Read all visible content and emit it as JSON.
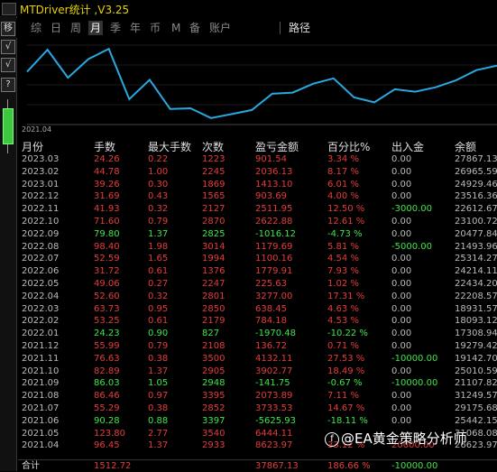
{
  "title": "MTDriver统计 ,V3.25",
  "tabs": [
    "综",
    "日",
    "周",
    "月",
    "季",
    "年",
    "币",
    "M",
    "备",
    "账户",
    "路径"
  ],
  "active_tab": "月",
  "left_buttons": [
    "移",
    "√",
    "√",
    "?"
  ],
  "chart_date": "2021.04",
  "headers": [
    "月份",
    "手数",
    "最大手数",
    "次数",
    "盈亏金额",
    "百分比%",
    "出入金",
    "余额"
  ],
  "rows": [
    [
      "2023.03",
      "24.26",
      "0.22",
      "1223",
      "901.54",
      "3.34 %",
      "0.00",
      "27867.13"
    ],
    [
      "2023.02",
      "44.78",
      "1.00",
      "2245",
      "2036.13",
      "8.17 %",
      "0.00",
      "26965.59"
    ],
    [
      "2023.01",
      "39.26",
      "0.30",
      "1869",
      "1413.10",
      "6.01 %",
      "0.00",
      "24929.46"
    ],
    [
      "2022.12",
      "31.69",
      "0.43",
      "1565",
      "903.69",
      "4.00 %",
      "0.00",
      "23516.36"
    ],
    [
      "2022.11",
      "41.93",
      "0.32",
      "2127",
      "2511.95",
      "12.50 %",
      "-3000.00",
      "22612.67"
    ],
    [
      "2022.10",
      "71.60",
      "0.79",
      "2870",
      "2622.88",
      "12.61 %",
      "0.00",
      "23100.72"
    ],
    [
      "2022.09",
      "79.80",
      "1.37",
      "2825",
      "-1016.12",
      "-4.73 %",
      "0.00",
      "20477.84"
    ],
    [
      "2022.08",
      "98.40",
      "1.98",
      "3014",
      "1179.69",
      "5.81 %",
      "-5000.00",
      "21493.96"
    ],
    [
      "2022.07",
      "52.59",
      "1.65",
      "1994",
      "1100.16",
      "4.54 %",
      "0.00",
      "25314.27"
    ],
    [
      "2022.06",
      "31.72",
      "0.61",
      "1376",
      "1779.91",
      "7.93 %",
      "0.00",
      "24214.11"
    ],
    [
      "2022.05",
      "49.06",
      "0.27",
      "2247",
      "225.63",
      "1.02 %",
      "0.00",
      "22434.20"
    ],
    [
      "2022.04",
      "52.60",
      "0.32",
      "2801",
      "3277.00",
      "17.31 %",
      "0.00",
      "22208.57"
    ],
    [
      "2022.03",
      "63.73",
      "0.95",
      "2850",
      "638.45",
      "4.63 %",
      "0.00",
      "18931.57"
    ],
    [
      "2022.02",
      "53.25",
      "0.61",
      "2179",
      "784.18",
      "4.53 %",
      "0.00",
      "18093.12"
    ],
    [
      "2022.01",
      "24.23",
      "0.90",
      "827",
      "-1970.48",
      "-10.22 %",
      "0.00",
      "17308.94"
    ],
    [
      "2021.12",
      "55.99",
      "0.79",
      "2108",
      "136.72",
      "0.71 %",
      "0.00",
      "19279.42"
    ],
    [
      "2021.11",
      "76.63",
      "0.38",
      "3500",
      "4132.11",
      "27.53 %",
      "-10000.00",
      "19142.70"
    ],
    [
      "2021.10",
      "82.89",
      "1.37",
      "2905",
      "3902.77",
      "18.49 %",
      "0.00",
      "25010.59"
    ],
    [
      "2021.09",
      "86.03",
      "1.05",
      "2948",
      "-141.75",
      "-0.67 %",
      "-10000.00",
      "21107.82"
    ],
    [
      "2021.08",
      "86.46",
      "0.97",
      "3395",
      "2073.89",
      "7.11 %",
      "0.00",
      "31249.57"
    ],
    [
      "2021.07",
      "55.29",
      "0.38",
      "2852",
      "3733.53",
      "14.67 %",
      "0.00",
      "29175.68"
    ],
    [
      "2021.06",
      "90.28",
      "0.88",
      "3397",
      "-5625.93",
      "-18.11 %",
      "0.00",
      "25442.15"
    ],
    [
      "2021.05",
      "123.80",
      "2.77",
      "3540",
      "6444.11",
      "",
      "",
      "31068.08"
    ],
    [
      "2021.04",
      "96.45",
      "1.37",
      "2933",
      "8623.97",
      "33.12 %",
      "20000.00",
      "26623.97"
    ]
  ],
  "total": [
    "合计",
    "1512.72",
    "",
    "",
    "37867.13",
    "186.66 %",
    "-10000.00",
    ""
  ],
  "watermark": "EA黄金策略分析师",
  "colors": {
    "positive": "#e63c3c",
    "negative": "#3ee64a",
    "neutral": "#bbbbbb",
    "line": "#29a8e0",
    "title": "#e6d200"
  },
  "chart_data": {
    "type": "line",
    "x": [
      "2021.04",
      "2021.05",
      "2021.06",
      "2021.07",
      "2021.08",
      "2021.09",
      "2021.10",
      "2021.11",
      "2021.12",
      "2022.01",
      "2022.02",
      "2022.03",
      "2022.04",
      "2022.05",
      "2022.06",
      "2022.07",
      "2022.08",
      "2022.09",
      "2022.10",
      "2022.11",
      "2022.12",
      "2023.01",
      "2023.02",
      "2023.03"
    ],
    "y": [
      26623.97,
      31068.08,
      25442.15,
      29175.68,
      31249.57,
      21107.82,
      25010.59,
      19142.7,
      19279.42,
      17308.94,
      18093.12,
      18931.57,
      22208.57,
      22434.2,
      24214.11,
      25314.27,
      21493.96,
      20477.84,
      23100.72,
      22612.67,
      23516.36,
      24929.46,
      26965.59,
      27867.13
    ]
  }
}
